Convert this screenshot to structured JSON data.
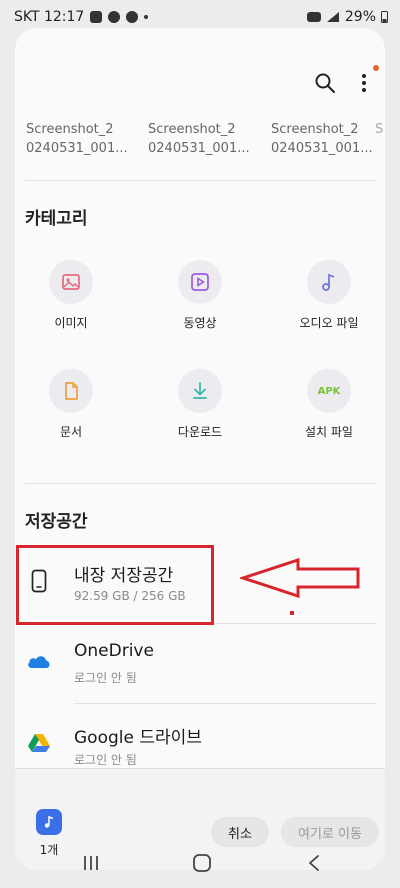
{
  "status_bar": {
    "carrier_time": "SKT 12:17",
    "battery": "29%"
  },
  "recent_files": [
    {
      "line1": "Screenshot_2",
      "line2": "0240531_001..."
    },
    {
      "line1": "Screenshot_2",
      "line2": "0240531_001..."
    },
    {
      "line1": "Screenshot_2",
      "line2": "0240531_001..."
    }
  ],
  "categories": {
    "title": "카테고리",
    "items": [
      {
        "label": "이미지",
        "icon": "image-icon",
        "color": "#e56a80"
      },
      {
        "label": "동영상",
        "icon": "video-icon",
        "color": "#9a5cd6"
      },
      {
        "label": "오디오 파일",
        "icon": "music-note-icon",
        "color": "#6b72d8"
      },
      {
        "label": "문서",
        "icon": "document-icon",
        "color": "#e9a03a"
      },
      {
        "label": "다운로드",
        "icon": "download-icon",
        "color": "#36b9a5"
      },
      {
        "label": "설치 파일",
        "icon": "apk-icon",
        "icon_text": "APK",
        "color": "#7ac23c"
      }
    ]
  },
  "storage": {
    "title": "저장공간",
    "items": [
      {
        "name": "내장 저장공간",
        "sub": "92.59 GB / 256 GB",
        "icon": "phone-icon"
      },
      {
        "name": "OneDrive",
        "sub": "로그인 안 됨",
        "icon": "onedrive-icon",
        "color": "#1f7fe0"
      },
      {
        "name": "Google 드라이브",
        "sub": "로그인 안 됨",
        "icon": "google-drive-icon"
      }
    ]
  },
  "bottom_bar": {
    "selected_count": "1개",
    "cancel_label": "취소",
    "move_label": "여기로 이동"
  },
  "colors": {
    "annotation_red": "#d6252c",
    "accent_dot": "#e4622c"
  }
}
